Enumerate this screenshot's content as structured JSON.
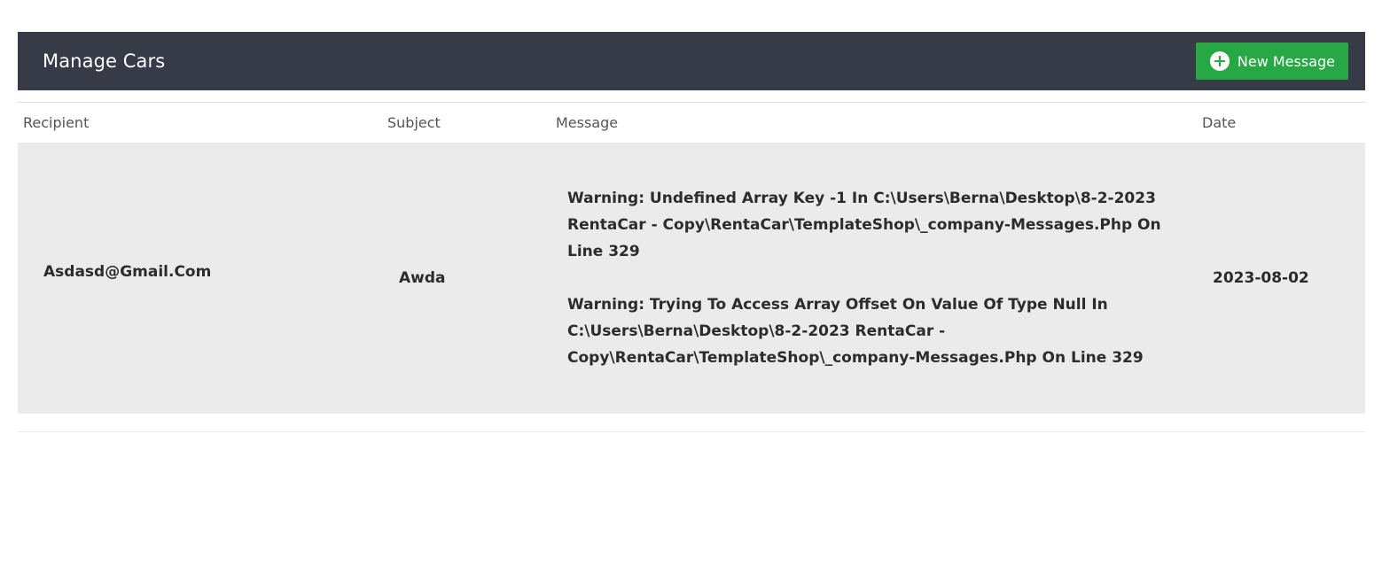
{
  "header": {
    "title": "Manage Cars",
    "new_message_label": "New Message"
  },
  "table": {
    "columns": [
      "Recipient",
      "Subject",
      "Message",
      "Date"
    ],
    "rows": [
      {
        "recipient": "Asdasd@Gmail.Com",
        "subject": "Awda",
        "messages": [
          "Warning: Undefined Array Key -1 In C:\\Users\\Berna\\Desktop\\8-2-2023 RentaCar - Copy\\RentaCar\\TemplateShop\\_company-Messages.Php On Line 329",
          "Warning: Trying To Access Array Offset On Value Of Type Null In C:\\Users\\Berna\\Desktop\\8-2-2023 RentaCar - Copy\\RentaCar\\TemplateShop\\_company-Messages.Php On Line 329"
        ],
        "date": "2023-08-02"
      }
    ]
  },
  "colors": {
    "header_bg": "#363b47",
    "button_bg": "#28a745",
    "row_bg": "#ebebeb"
  }
}
